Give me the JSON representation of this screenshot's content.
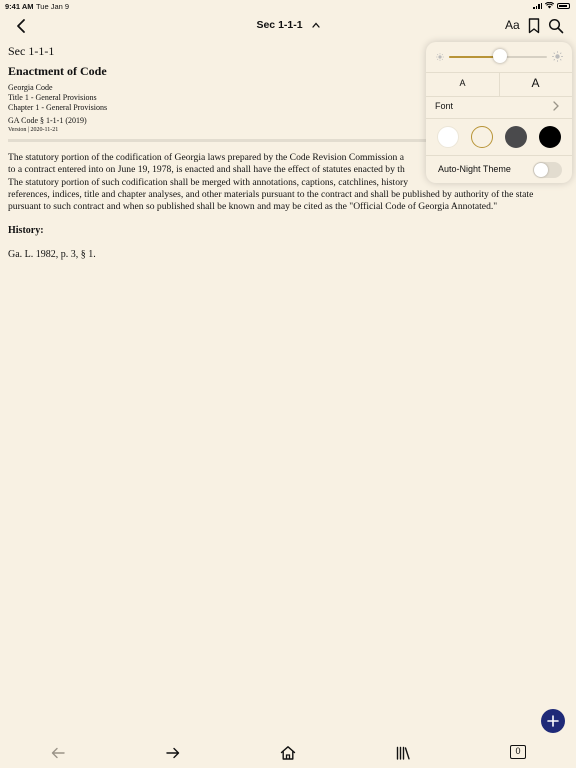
{
  "status_bar": {
    "time": "9:41 AM",
    "date": "Tue Jan 9"
  },
  "nav": {
    "title": "Sec 1-1-1",
    "aa_label": "Aa"
  },
  "document": {
    "section": "Sec 1-1-1",
    "title": "Enactment of Code",
    "meta": [
      "Georgia Code",
      "Title 1 - General Provisions",
      "Chapter 1 - General Provisions"
    ],
    "ga_code": "GA Code § 1-1-1 (2019)",
    "version": "Version | 2020-11-21",
    "paragraph": [
      "The statutory portion of the codification of Georgia laws prepared by the Code Revision Commission a",
      "to a contract entered into on June 19, 1978, is enacted and shall have the effect of statutes enacted by th",
      "The statutory portion of such codification shall be merged with annotations, captions, catchlines, history",
      "references, indices, title and chapter analyses, and other materials pursuant to the contract and shall be published by authority of the state",
      "pursuant to such contract and when so published shall be known and may be cited as the \"Official Code of Georgia Annotated.\""
    ],
    "history_label": "History:",
    "history_text": "Ga. L. 1982, p. 3, § 1."
  },
  "popover": {
    "brightness_level": 0.52,
    "font_size_small_label": "A",
    "font_size_large_label": "A",
    "font_label": "Font",
    "auto_night_label": "Auto-Night Theme",
    "auto_night_on": false,
    "themes": [
      {
        "name": "white",
        "color": "#ffffff",
        "selected": false
      },
      {
        "name": "sepia",
        "color": "#f8f1e3",
        "selected": true
      },
      {
        "name": "gray",
        "color": "#4a4a4c",
        "selected": false
      },
      {
        "name": "black",
        "color": "#000000",
        "selected": false
      }
    ],
    "accent_color": "#b89437"
  },
  "toolbar": {
    "tab_count": "0"
  },
  "colors": {
    "background": "#f8f1e3",
    "fab": "#1f2a78"
  }
}
